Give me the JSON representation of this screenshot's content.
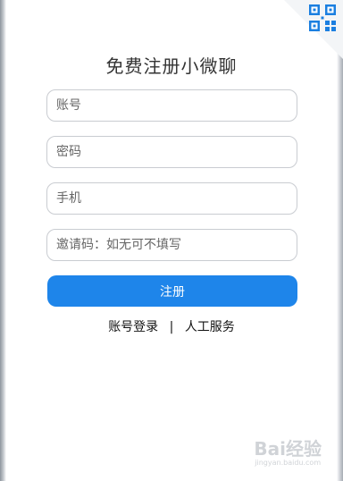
{
  "header": {
    "title": "免费注册小微聊",
    "qr_icon": "qr-code-icon"
  },
  "form": {
    "account_placeholder": "账号",
    "password_placeholder": "密码",
    "phone_placeholder": "手机",
    "invite_placeholder": "邀请码：如无可不填写",
    "register_label": "注册"
  },
  "links": {
    "login_label": "账号登录",
    "separator": "|",
    "support_label": "人工服务"
  },
  "watermark": {
    "logo_text": "Bai经验",
    "url": "jingyan.baidu.com"
  },
  "colors": {
    "accent": "#1e85ea",
    "qr": "#1b7fe0"
  }
}
